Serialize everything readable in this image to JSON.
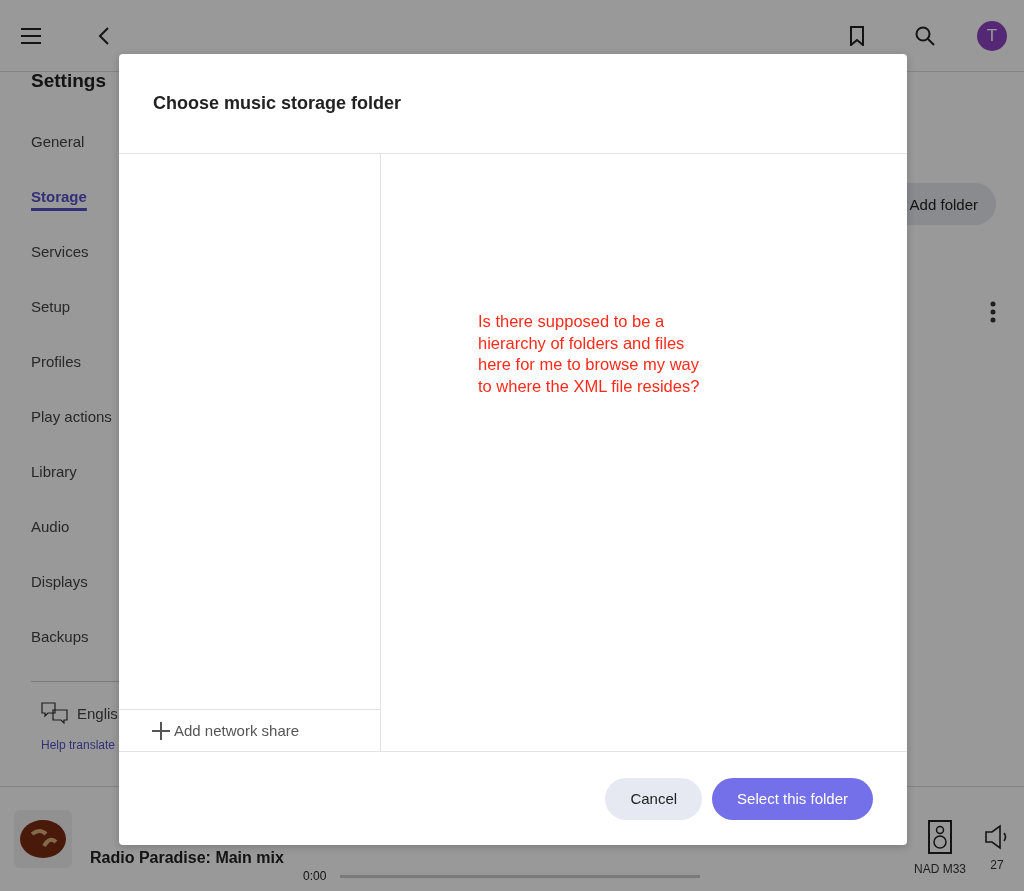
{
  "avatar": {
    "initial": "T"
  },
  "sidebar": {
    "title": "Settings",
    "items": [
      {
        "label": "General",
        "selected": false
      },
      {
        "label": "Storage",
        "selected": true
      },
      {
        "label": "Services",
        "selected": false
      },
      {
        "label": "Setup",
        "selected": false
      },
      {
        "label": "Profiles",
        "selected": false
      },
      {
        "label": "Play actions",
        "selected": false
      },
      {
        "label": "Library",
        "selected": false
      },
      {
        "label": "Audio",
        "selected": false
      },
      {
        "label": "Displays",
        "selected": false
      },
      {
        "label": "Backups",
        "selected": false
      }
    ],
    "language": "Englis",
    "help_link": "Help translate"
  },
  "content": {
    "add_button": "Add folder"
  },
  "player": {
    "title": "Radio Paradise: Main mix",
    "time": "0:00",
    "level": 0,
    "device": "NAD M33",
    "volume": "27"
  },
  "dialog": {
    "title": "Choose music storage folder",
    "add_share": "Add network share",
    "annotation": "Is there supposed to be a hierarchy of folders and files here for me to browse my way to where the XML file resides?",
    "buttons": [
      {
        "label": "Cancel",
        "kind": "secondary"
      },
      {
        "label": "Select this folder",
        "kind": "primary"
      }
    ]
  }
}
